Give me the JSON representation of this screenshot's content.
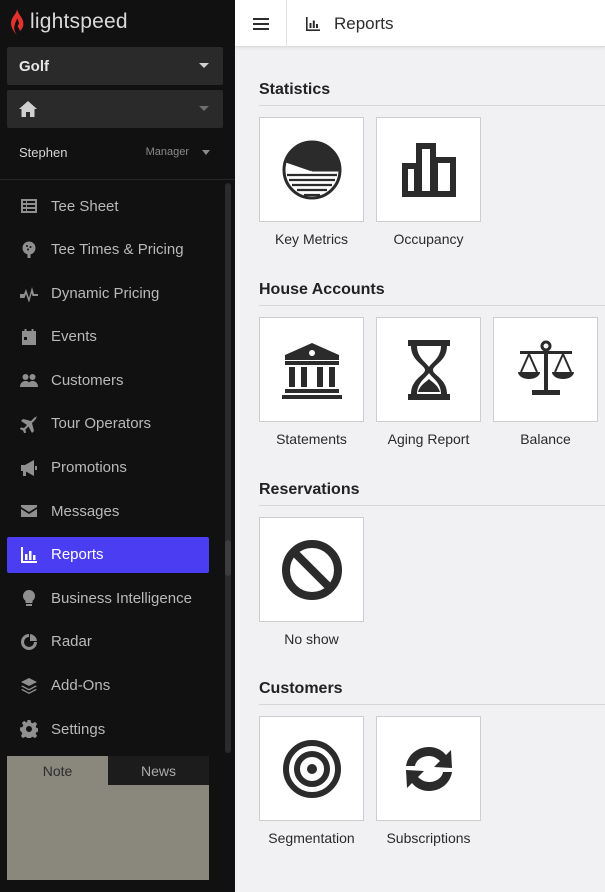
{
  "brand": {
    "name": "lightspeed",
    "accent": "#4b3ef2",
    "logo_color": "#e3322b"
  },
  "sidebar": {
    "course_select": {
      "value": "Golf"
    },
    "location_select": {
      "icon": "home-icon"
    },
    "user": {
      "name": "Stephen",
      "role": "Manager"
    },
    "nav": [
      {
        "label": "Tee Sheet",
        "icon": "table-icon"
      },
      {
        "label": "Tee Times & Pricing",
        "icon": "golf-ball-icon"
      },
      {
        "label": "Dynamic Pricing",
        "icon": "pulse-icon"
      },
      {
        "label": "Events",
        "icon": "calendar-icon"
      },
      {
        "label": "Customers",
        "icon": "users-icon"
      },
      {
        "label": "Tour Operators",
        "icon": "plane-icon"
      },
      {
        "label": "Promotions",
        "icon": "megaphone-icon"
      },
      {
        "label": "Messages",
        "icon": "envelope-icon"
      },
      {
        "label": "Reports",
        "icon": "bar-chart-icon",
        "active": true
      },
      {
        "label": "Business Intelligence",
        "icon": "lightbulb-icon"
      },
      {
        "label": "Radar",
        "icon": "radar-icon"
      },
      {
        "label": "Add-Ons",
        "icon": "layers-icon"
      },
      {
        "label": "Settings",
        "icon": "gear-icon"
      }
    ],
    "note_panel": {
      "tabs": [
        "Note",
        "News"
      ],
      "active_tab": "Note"
    }
  },
  "topbar": {
    "title": "Reports"
  },
  "sections": [
    {
      "title": "Statistics",
      "tiles": [
        {
          "label": "Key Metrics",
          "icon": "pie-chart-icon"
        },
        {
          "label": "Occupancy",
          "icon": "building-chart-icon"
        }
      ]
    },
    {
      "title": "House Accounts",
      "tiles": [
        {
          "label": "Statements",
          "icon": "bank-icon"
        },
        {
          "label": "Aging Report",
          "icon": "hourglass-icon"
        },
        {
          "label": "Balance",
          "icon": "scale-icon"
        }
      ]
    },
    {
      "title": "Reservations",
      "tiles": [
        {
          "label": "No show",
          "icon": "ban-icon"
        }
      ]
    },
    {
      "title": "Customers",
      "tiles": [
        {
          "label": "Segmentation",
          "icon": "target-icon"
        },
        {
          "label": "Subscriptions",
          "icon": "sync-icon"
        }
      ]
    }
  ]
}
